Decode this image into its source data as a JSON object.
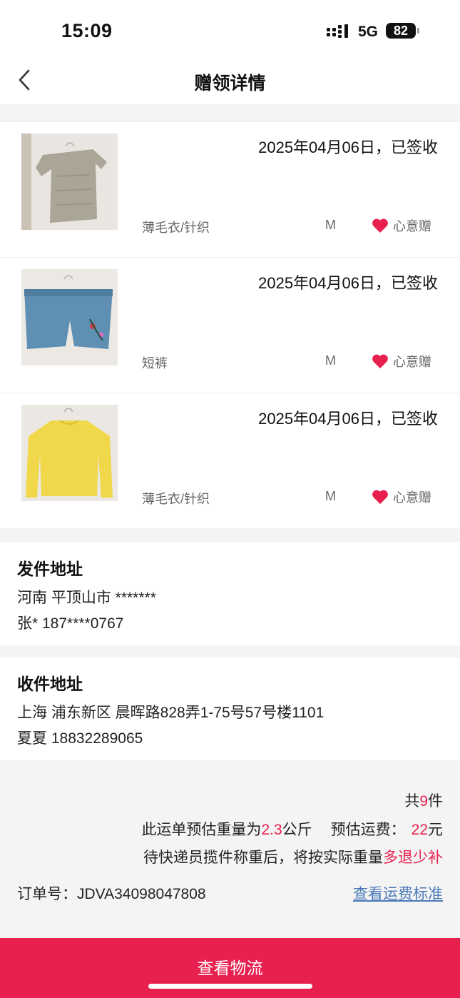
{
  "status_bar": {
    "time": "15:09",
    "network": "5G",
    "battery": "82"
  },
  "nav": {
    "title": "赠领详情"
  },
  "items": [
    {
      "date_status": "2025年04月06日，已签收",
      "category": "薄毛衣/针织",
      "size": "M",
      "tag": "心意赠",
      "thumb": "grey-top"
    },
    {
      "date_status": "2025年04月06日，已签收",
      "category": "短裤",
      "size": "M",
      "tag": "心意赠",
      "thumb": "denim-shorts"
    },
    {
      "date_status": "2025年04月06日，已签收",
      "category": "薄毛衣/针织",
      "size": "M",
      "tag": "心意赠",
      "thumb": "yellow-sweater"
    }
  ],
  "sender": {
    "title": "发件地址",
    "region": "河南 平顶山市 *******",
    "contact": "张* 187****0767"
  },
  "receiver": {
    "title": "收件地址",
    "address": "上海 浦东新区 晨晖路828弄1-75号57号楼1101",
    "contact": "夏夏 18832289065"
  },
  "summary": {
    "count_prefix": "共",
    "count": "9",
    "count_suffix": "件",
    "weight_prefix": "此运单预估重量为",
    "weight": "2.3",
    "weight_unit": "公斤",
    "fee_label": "预估运费：",
    "fee": "22",
    "fee_unit": "元",
    "note_prefix": "待快递员揽件称重后，将按实际重量",
    "note_highlight": "多退少补",
    "order_label": "订单号：",
    "order_no": "JDVA34098047808",
    "fee_link": "查看运费标准"
  },
  "bottom_button": "查看物流",
  "colors": {
    "accent": "#e8204f",
    "link": "#4a78b8"
  }
}
